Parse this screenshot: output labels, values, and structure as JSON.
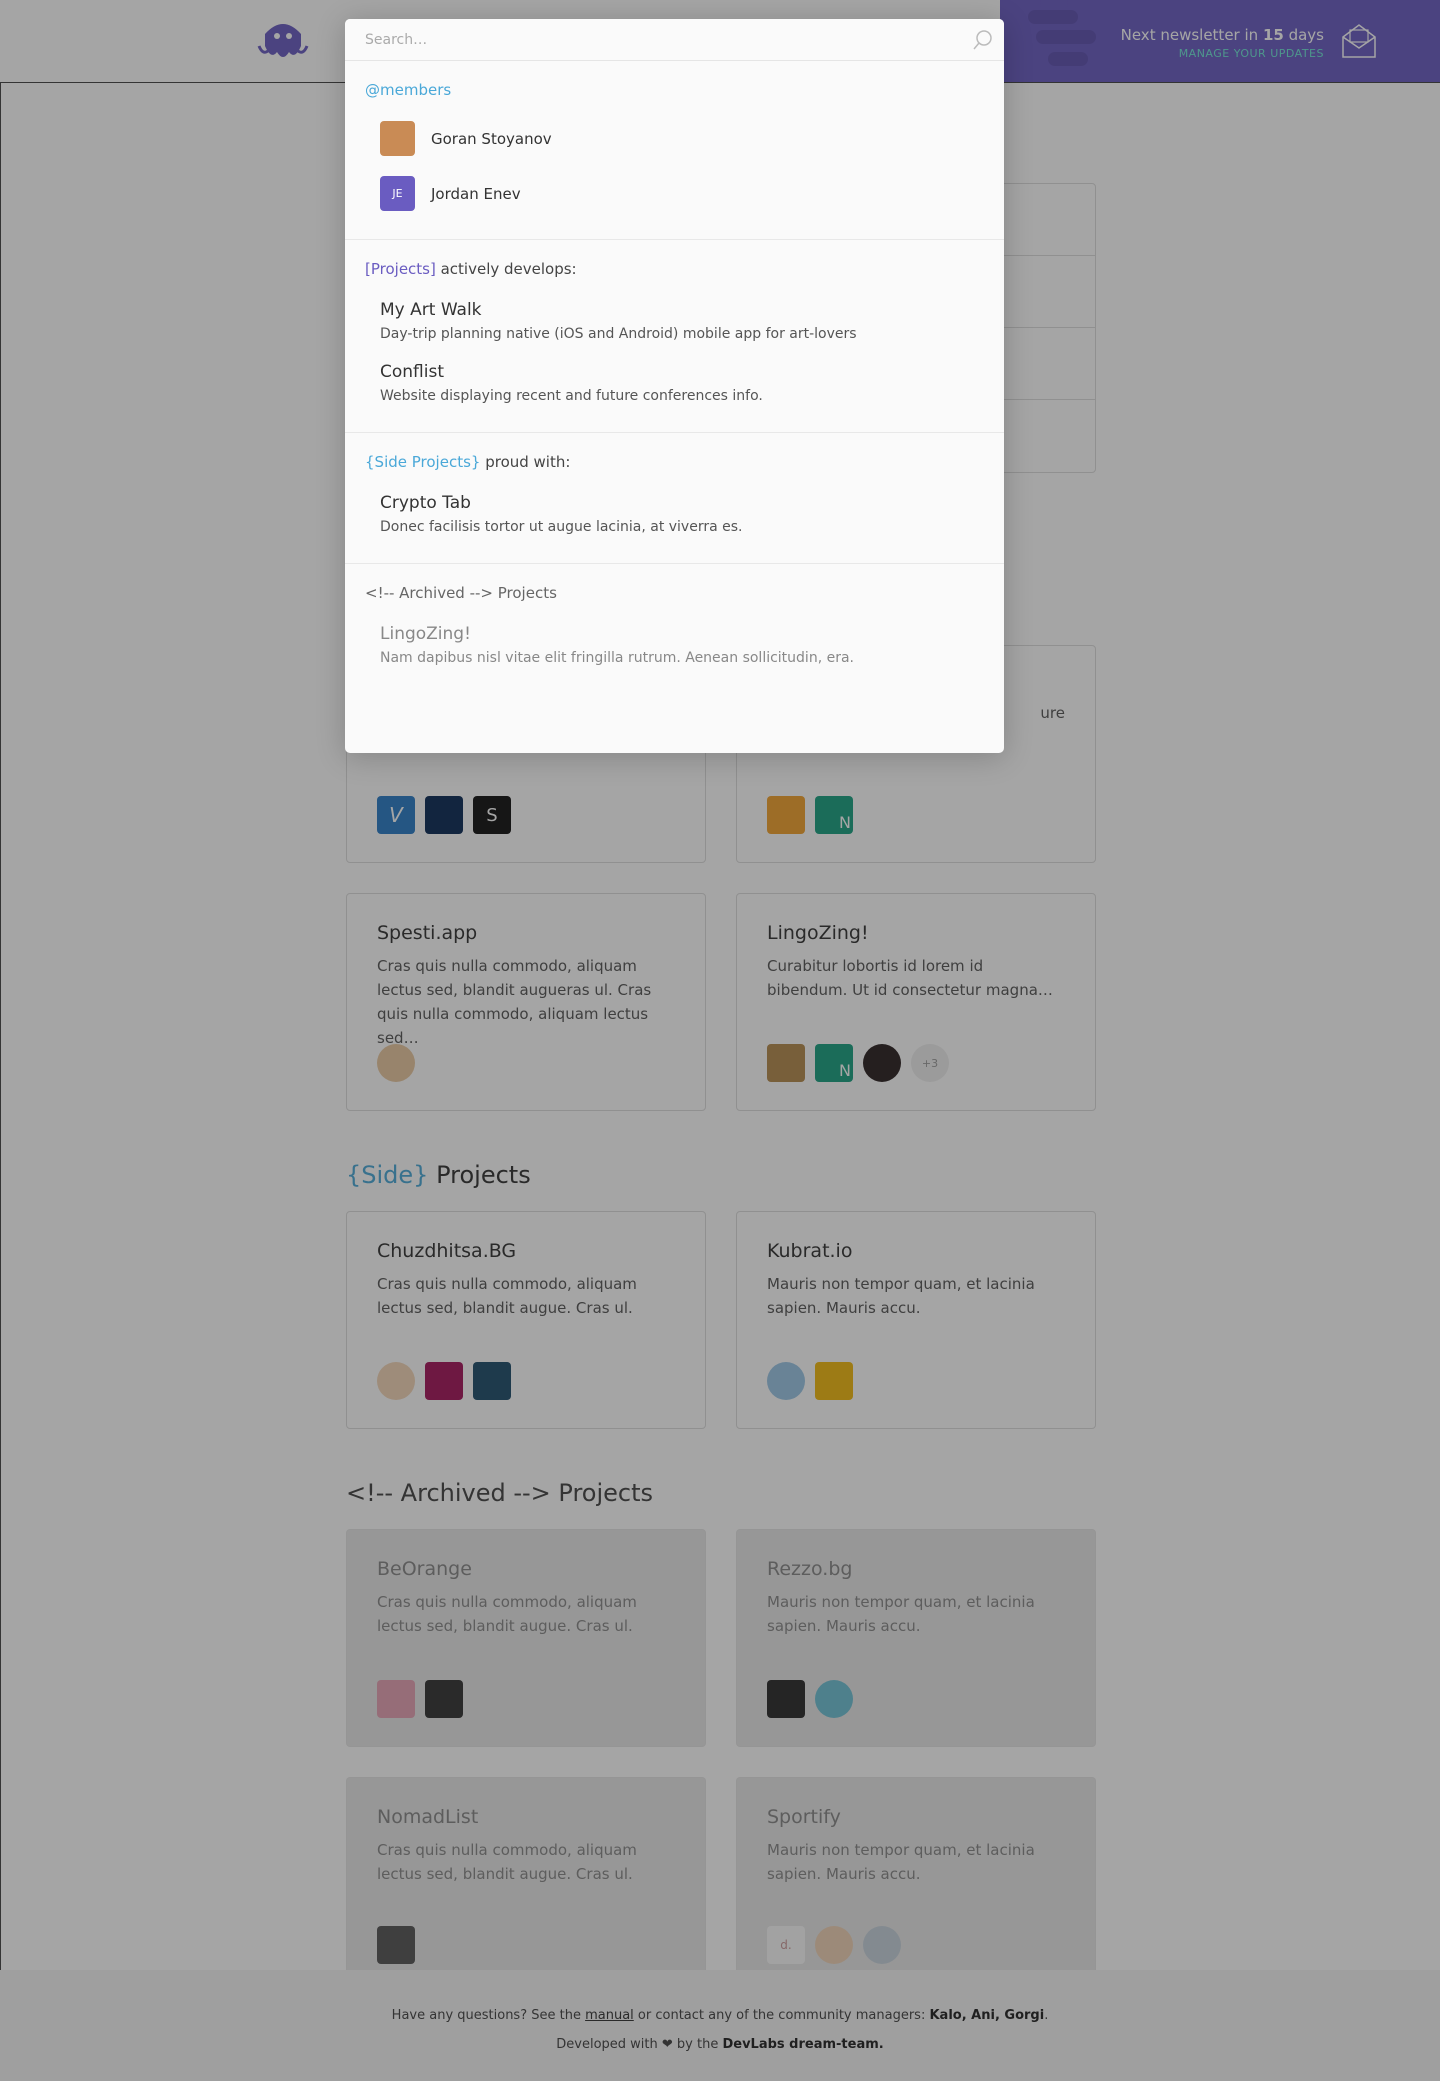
{
  "header": {
    "newsletter_prefix": "Next newsletter in",
    "newsletter_days": "15",
    "newsletter_suffix": "days",
    "manage_label": "MANAGE YOUR UPDATES"
  },
  "page": {
    "side_section": {
      "accent": "{Side}",
      "rest": " Projects"
    },
    "archived_section": {
      "text": "<!-- Archived --> Projects"
    },
    "partial_card_text": "ure",
    "project_cards": [
      {
        "title": "Spesti.app",
        "desc": "Cras quis nulla commodo, aliquam lectus sed, blandit augueras ul. Cras quis nulla commodo, aliquam lectus sed…"
      },
      {
        "title": "LingoZing!",
        "desc": "Curabitur lobortis id lorem id bibendum. Ut id consectetur magna…",
        "more": "+3"
      }
    ],
    "side_cards": [
      {
        "title": "Chuzdhitsa.BG",
        "desc": "Cras quis nulla commodo, aliquam lectus sed, blandit augue. Cras ul."
      },
      {
        "title": "Kubrat.io",
        "desc": "Mauris non tempor quam, et lacinia sapien. Mauris accu."
      }
    ],
    "archived_cards": [
      {
        "title": "BeOrange",
        "desc": "Cras quis nulla commodo, aliquam lectus sed, blandit augue. Cras ul."
      },
      {
        "title": "Rezzo.bg",
        "desc": "Mauris non tempor quam, et lacinia sapien. Mauris accu."
      },
      {
        "title": "NomadList",
        "desc": "Cras quis nulla commodo, aliquam lectus sed, blandit augue. Cras ul."
      },
      {
        "title": "Sportify",
        "desc": "Mauris non tempor quam, et lacinia sapien. Mauris accu."
      }
    ],
    "avatar_labels": {
      "v": "V",
      "s": "S",
      "n": "N",
      "d": "d."
    }
  },
  "footer": {
    "line1_prefix": "Have any questions? See the",
    "manual": "manual",
    "line1_mid": "or contact any of the community managers:",
    "managers": "Kalo, Ani, Gorgi",
    "line2_prefix": "Developed with ❤ by the",
    "team": "DevLabs dream-team."
  },
  "search_modal": {
    "placeholder": "Search…",
    "members_title": "@members",
    "members": [
      {
        "name": "Goran Stoyanov"
      },
      {
        "name": "Jordan Enev",
        "initials": "JE"
      }
    ],
    "projects_title_accent": "[Projects]",
    "projects_title_rest": " actively develops:",
    "projects": [
      {
        "title": "My Art Walk",
        "desc": "Day-trip planning native (iOS and Android) mobile app for art-lovers"
      },
      {
        "title": "Conflist",
        "desc": "Website displaying recent and future conferences info."
      }
    ],
    "side_title_accent": "{Side Projects}",
    "side_title_rest": " proud with:",
    "side_projects": [
      {
        "title": "Crypto Tab",
        "desc": "Donec facilisis tortor ut augue lacinia, at viverra es."
      }
    ],
    "archived_title": "<!-- Archived --> Projects",
    "archived": [
      {
        "title": "LingoZing!",
        "desc": "Nam dapibus nisl vitae elit fringilla rutrum. Aenean sollicitudin, era."
      }
    ]
  },
  "colors": {
    "brand": "#6a5cc1",
    "accent": "#4aa8d8",
    "teal": "#6ee7d6"
  },
  "icons": [
    "octopus-logo-icon",
    "mail-icon",
    "search-icon"
  ]
}
